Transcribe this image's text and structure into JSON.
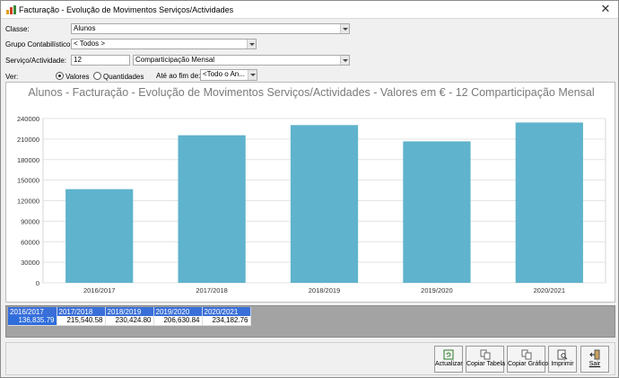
{
  "window": {
    "title": "Facturação - Evolução de Movimentos Serviços/Actividades",
    "close": "✕"
  },
  "filters": {
    "classe_label": "Classe:",
    "classe_value": "Alunos",
    "grupo_label": "Grupo Contabilístico:",
    "grupo_value": "< Todos >",
    "servico_label": "Serviço/Actividade:",
    "servico_code": "12",
    "servico_value": "Comparticipação Mensal",
    "ver_label": "Ver:",
    "radio_valores": "Valores",
    "radio_quantidades": "Quantidades",
    "ate_label": "Até ao fim de:",
    "ate_value": "<Todo o An..."
  },
  "chart_data": {
    "type": "bar",
    "title": "Alunos - Facturação - Evolução de Movimentos Serviços/Actividades - Valores em € - 12 Comparticipação Mensal",
    "categories": [
      "2016/2017",
      "2017/2018",
      "2018/2019",
      "2019/2020",
      "2020/2021"
    ],
    "values": [
      136835.79,
      215540.58,
      230424.8,
      206630.84,
      234182.76
    ],
    "ylim": [
      0,
      240000
    ],
    "yticks": [
      0,
      30000,
      60000,
      90000,
      120000,
      150000,
      180000,
      210000,
      240000
    ],
    "ytick_labels": [
      "0",
      "30000",
      "60000",
      "90000",
      "120000",
      "150000",
      "180000",
      "210000",
      "240000"
    ],
    "bar_color": "#5fb3cc",
    "grid": true
  },
  "table": {
    "headers": [
      "2016/2017",
      "2017/2018",
      "2018/2019",
      "2019/2020",
      "2020/2021"
    ],
    "values": [
      "136,835.79",
      "215,540.58",
      "230,424.80",
      "206,630.84",
      "234,182.76"
    ]
  },
  "buttons": {
    "actualizar": "Actualizar",
    "copiar_tabela": "Copiar Tabela",
    "copiar_grafico": "Copiar Gráfico",
    "imprimir": "Imprimir",
    "sair": "Sair"
  }
}
